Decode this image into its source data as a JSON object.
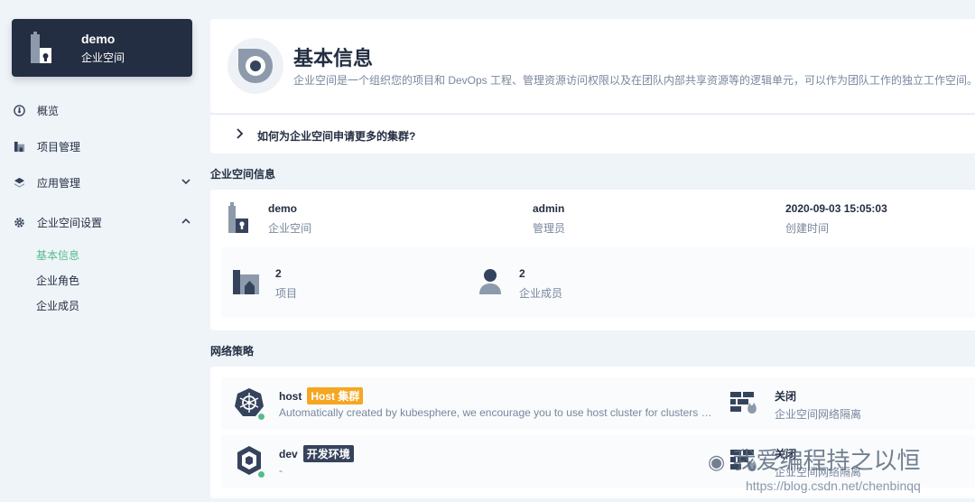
{
  "sidebar": {
    "workspace_name": "demo",
    "workspace_type": "企业空间",
    "items": [
      {
        "label": "概览",
        "icon": "dashboard-icon"
      },
      {
        "label": "项目管理",
        "icon": "project-icon"
      },
      {
        "label": "应用管理",
        "icon": "layers-icon"
      },
      {
        "label": "企业空间设置",
        "icon": "gear-icon"
      }
    ],
    "sub_items": [
      {
        "label": "基本信息",
        "active": true
      },
      {
        "label": "企业角色",
        "active": false
      },
      {
        "label": "企业成员",
        "active": false
      }
    ]
  },
  "header": {
    "title": "基本信息",
    "description": "企业空间是一个组织您的项目和 DevOps 工程、管理资源访问权限以及在团队内部共享资源等的逻辑单元，可以作为团队工作的独立工作空间。",
    "faq": "如何为企业空间申请更多的集群?"
  },
  "workspace_info": {
    "section_title": "企业空间信息",
    "name": "demo",
    "name_label": "企业空间",
    "manager": "admin",
    "manager_label": "管理员",
    "created": "2020-09-03 15:05:03",
    "created_label": "创建时间",
    "projects_count": "2",
    "projects_label": "项目",
    "members_count": "2",
    "members_label": "企业成员"
  },
  "network": {
    "section_title": "网络策略",
    "clusters": [
      {
        "name": "host",
        "tag": "Host 集群",
        "tag_color": "#f5a623",
        "description": "Automatically created by kubesphere, we encourage you to use host cluster for clusters …",
        "isolation_status": "关闭",
        "isolation_label": "企业空间网络隔离"
      },
      {
        "name": "dev",
        "tag": "开发环境",
        "tag_color": "#36435c",
        "description": "-",
        "isolation_status": "关闭",
        "isolation_label": "企业空间网络隔离"
      }
    ]
  },
  "watermark": {
    "text": "我爱编程持之以恒",
    "url": "https://blog.csdn.net/chenbinqq"
  },
  "colors": {
    "accent": "#55bc8a",
    "dark": "#242e42",
    "muted": "#79879c",
    "background": "#eff4f9"
  }
}
